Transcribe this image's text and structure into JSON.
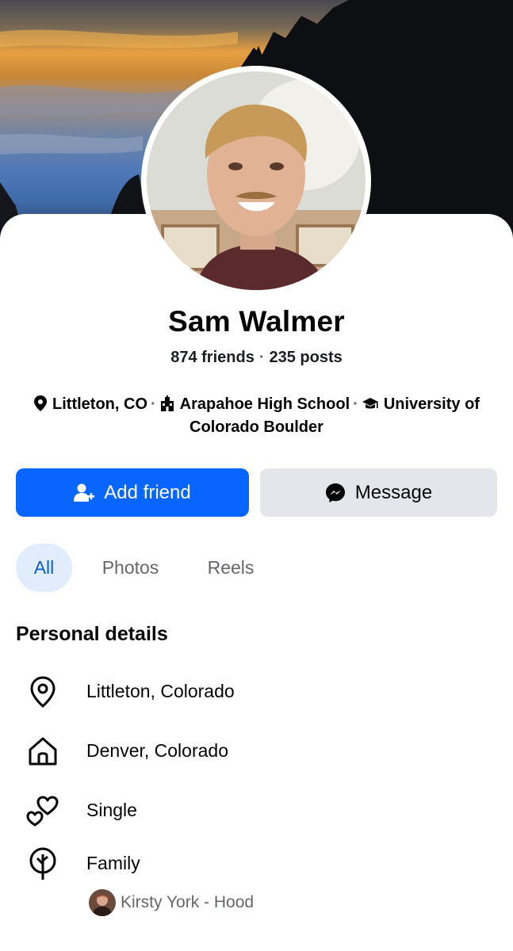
{
  "profile": {
    "name": "Sam Walmer",
    "friends": "874 friends",
    "posts": "235 posts",
    "stats_sep": "·",
    "location": "Littleton, CO",
    "high_school": "Arapahoe High School",
    "university_line1": "University of",
    "university_line2": "Colorado Boulder",
    "info_sep": "·"
  },
  "actions": {
    "add_friend": "Add friend",
    "message": "Message"
  },
  "tabs": [
    {
      "label": "All",
      "active": true
    },
    {
      "label": "Photos",
      "active": false
    },
    {
      "label": "Reels",
      "active": false
    }
  ],
  "personal_details": {
    "title": "Personal details",
    "items": [
      {
        "icon": "location-pin-icon",
        "text": "Littleton, Colorado"
      },
      {
        "icon": "home-icon",
        "text": "Denver, Colorado"
      },
      {
        "icon": "hearts-icon",
        "text": "Single"
      },
      {
        "icon": "tree-icon",
        "text": "Family"
      }
    ],
    "family_member": "Kirsty York - Hood"
  },
  "colors": {
    "primary_blue": "#0866ff",
    "secondary_gray": "#e4e6eb",
    "active_tab_bg": "#e1edfc",
    "active_tab_text": "#0a5ec8",
    "muted_text": "#65676b"
  }
}
